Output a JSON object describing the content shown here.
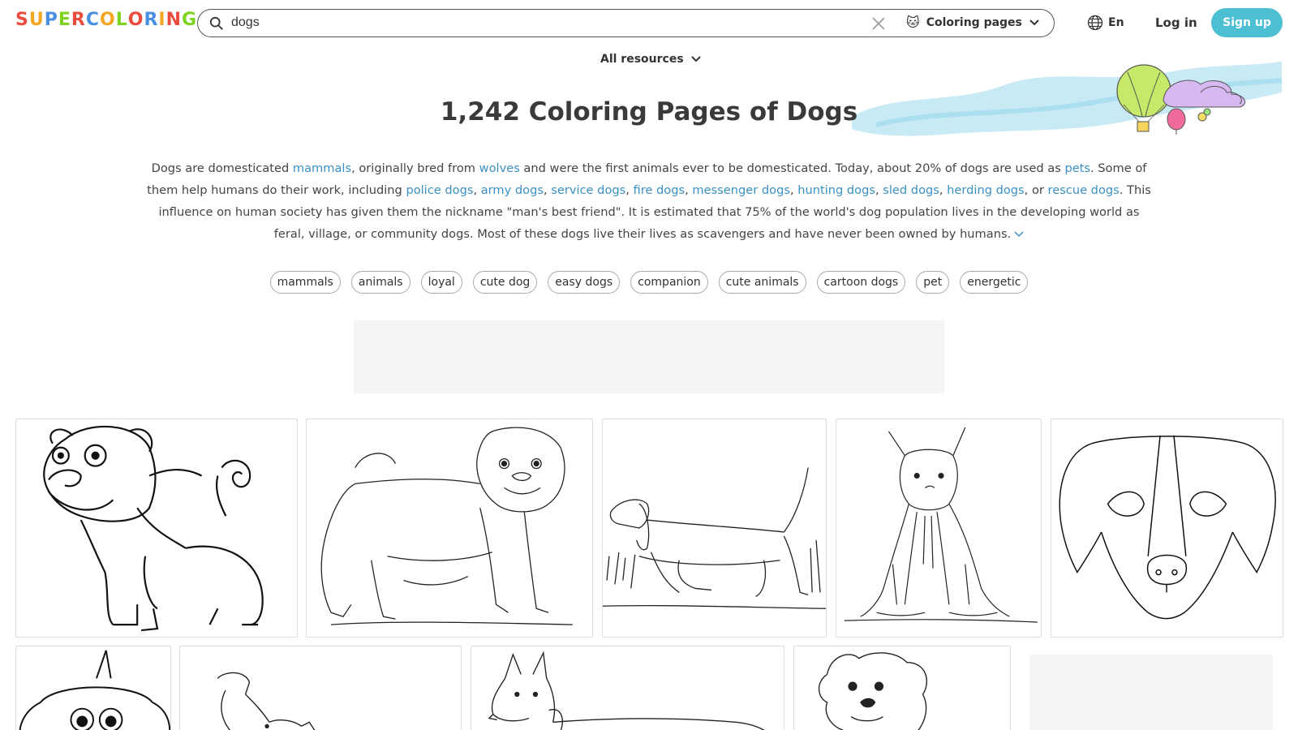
{
  "header": {
    "logo_letters": [
      "S",
      "U",
      "P",
      "E",
      "R",
      "C",
      "O",
      "L",
      "O",
      "R",
      "I",
      "N",
      "G"
    ],
    "logo_colors": [
      "#e94b3c",
      "#f5a623",
      "#4a90e2",
      "#7ed321",
      "#e94b3c",
      "#4a90e2",
      "#f5a623",
      "#7ed321",
      "#e94b3c",
      "#4a90e2",
      "#f5a623",
      "#e94b3c",
      "#7ed321"
    ],
    "search_value": "dogs",
    "category_emoji": "🐱",
    "category_label": "Coloring pages",
    "lang": "En",
    "login": "Log in",
    "signup": "Sign up"
  },
  "filter": {
    "all_resources": "All resources"
  },
  "title": "1,242 Coloring Pages of Dogs",
  "description": {
    "p1": "Dogs are domesticated ",
    "l_mammals": "mammals",
    "p2": ", originally bred from ",
    "l_wolves": "wolves",
    "p3": " and were the first animals ever to be domesticated. Today, about 20% of dogs are used as ",
    "l_pets": "pets",
    "p4": ". Some of them help humans do their work, including ",
    "l_police": "police dogs",
    "c1": ", ",
    "l_army": "army dogs",
    "c2": ", ",
    "l_service": "service dogs",
    "c3": ", ",
    "l_fire": "fire dogs",
    "c4": ", ",
    "l_messenger": "messenger dogs",
    "c5": ", ",
    "l_hunting": "hunting dogs",
    "c6": ", ",
    "l_sled": "sled dogs",
    "c7": ", ",
    "l_herding": "herding dogs",
    "c8": ", or ",
    "l_rescue": "rescue dogs",
    "p5": ". This influence on human society has given them the nickname \"man's best friend\". It is estimated that 75% of the world's dog population lives in the developing world as feral, village, or community dogs. Most of these dogs live their lives as scavengers and have never been owned by humans."
  },
  "tags": [
    "mammals",
    "animals",
    "loyal",
    "cute dog",
    "easy dogs",
    "companion",
    "cute animals",
    "cartoon dogs",
    "pet",
    "energetic"
  ],
  "colors": {
    "accent": "#4dbfd3",
    "link": "#3a90c2"
  }
}
